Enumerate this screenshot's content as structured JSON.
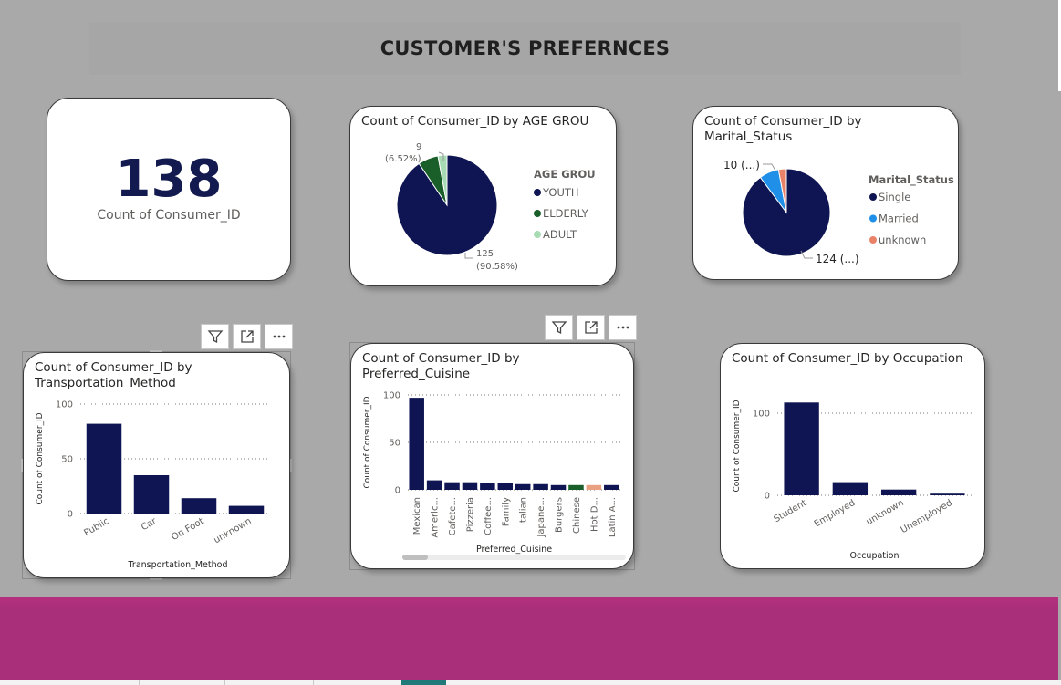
{
  "page": {
    "title": "CUSTOMER'S PREFERNCES"
  },
  "kpi": {
    "value": "138",
    "label": "Count of Consumer_ID"
  },
  "age_chart": {
    "title": "Count of Consumer_ID by AGE GROU",
    "legend_title": "AGE  GROU",
    "labels": {
      "small_count": "9",
      "small_pct": "(6.52%)",
      "big_count": "125",
      "big_pct": "(90.58%)"
    },
    "chart_data": {
      "type": "pie",
      "title": "Count of Consumer_ID by AGE GROU",
      "legend_title": "AGE  GROU",
      "legend_position": "right",
      "slices": [
        {
          "label": "YOUTH",
          "value": 125,
          "color": "#0f1552"
        },
        {
          "label": "ELDERLY",
          "value": 9,
          "color": "#1a5e2a"
        },
        {
          "label": "ADULT",
          "value": 4,
          "color": "#a7dbb3"
        }
      ]
    }
  },
  "marital_chart": {
    "title_line1": "Count of Consumer_ID by",
    "title_line2": "Marital_Status",
    "legend_title": "Marital_Status",
    "labels": {
      "small": "10 (...)",
      "big": "124 (...)"
    },
    "chart_data": {
      "type": "pie",
      "title": "Count of Consumer_ID by Marital_Status",
      "legend_title": "Marital_Status",
      "legend_position": "right",
      "slices": [
        {
          "label": "Single",
          "value": 124,
          "color": "#0f1552"
        },
        {
          "label": "Married",
          "value": 10,
          "color": "#1f8fe8"
        },
        {
          "label": "unknown",
          "value": 4,
          "color": "#e8836a"
        }
      ]
    }
  },
  "transport_chart": {
    "title_line1": "Count of Consumer_ID by",
    "title_line2": "Transportation_Method",
    "chart_data": {
      "type": "bar",
      "title": "Count of Consumer_ID by Transportation_Method",
      "xlabel": "Transportation_Method",
      "ylabel": "Count of Consumer_ID",
      "ylim": [
        0,
        100
      ],
      "yticks": [
        "100",
        "50",
        "0"
      ],
      "grid": true,
      "categories": [
        "Public",
        "Car",
        "On Foot",
        "unknown"
      ],
      "values": [
        82,
        35,
        14,
        7
      ],
      "color": "#0f1552"
    }
  },
  "cuisine_chart": {
    "title_line1": "Count of Consumer_ID by",
    "title_line2": "Preferred_Cuisine",
    "chart_data": {
      "type": "bar",
      "title": "Count of Consumer_ID by Preferred_Cuisine",
      "xlabel": "Preferred_Cuisine",
      "ylabel": "Count of Consumer_ID",
      "ylim": [
        0,
        100
      ],
      "yticks": [
        "100",
        "50",
        "0"
      ],
      "grid": true,
      "categories": [
        "Mexican",
        "Americ...",
        "Cafete...",
        "Pizzeria",
        "Coffee...",
        "Family",
        "Italian",
        "Japane...",
        "Burgers",
        "Chinese",
        "Hot D...",
        "Latin A..."
      ],
      "values": [
        97,
        10,
        8,
        8,
        7,
        7,
        6,
        6,
        5,
        5,
        5,
        5
      ],
      "colors": [
        "#0f1552",
        "#0f1552",
        "#0f1552",
        "#0f1552",
        "#0f1552",
        "#0f1552",
        "#0f1552",
        "#0f1552",
        "#0f1552",
        "#1a5e2a",
        "#e8a080",
        "#0f1552"
      ]
    }
  },
  "occupation_chart": {
    "title": "Count of Consumer_ID by Occupation",
    "chart_data": {
      "type": "bar",
      "title": "Count of Consumer_ID by Occupation",
      "xlabel": "Occupation",
      "ylabel": "Count of Consumer_ID",
      "ylim": [
        0,
        120
      ],
      "yticks": [
        "100",
        "0"
      ],
      "grid": true,
      "categories": [
        "Student",
        "Employed",
        "unknown",
        "Unemployed"
      ],
      "values": [
        113,
        16,
        7,
        2
      ],
      "color": "#0f1552"
    }
  },
  "toolbar_icons": [
    "filter-icon",
    "focus-mode-icon",
    "more-options-icon"
  ]
}
